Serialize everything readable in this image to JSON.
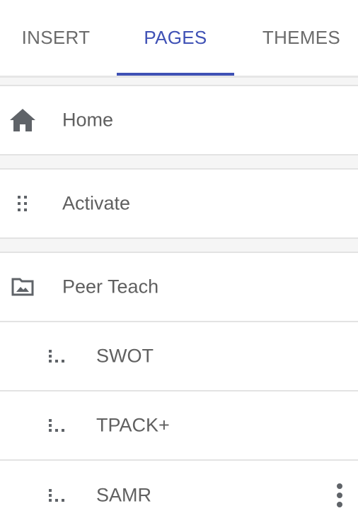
{
  "tabs": [
    {
      "label": "INSERT",
      "active": false
    },
    {
      "label": "PAGES",
      "active": true
    },
    {
      "label": "THEMES",
      "active": false
    }
  ],
  "colors": {
    "accent": "#3f51b5",
    "text": "#606060",
    "tab_inactive": "#6b6b6b",
    "divider": "#e3e3e3",
    "icon": "#5f6368"
  },
  "pages": [
    {
      "label": "Home",
      "icon": "home-icon",
      "level": 0
    },
    {
      "label": "Activate",
      "icon": "drag-handle-icon",
      "level": 0
    },
    {
      "label": "Peer Teach",
      "icon": "folder-icon",
      "level": 0
    },
    {
      "label": "SWOT",
      "icon": "subpage-drag-icon",
      "level": 1
    },
    {
      "label": "TPACK+",
      "icon": "subpage-drag-icon",
      "level": 1
    },
    {
      "label": "SAMR",
      "icon": "subpage-drag-icon",
      "level": 1,
      "more_icon": "more-vert-icon"
    }
  ]
}
